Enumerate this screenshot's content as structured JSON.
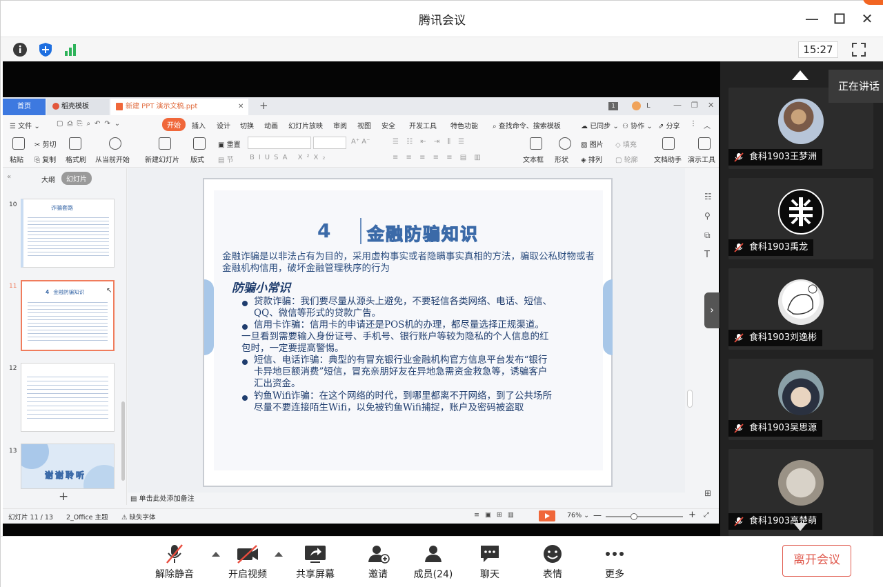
{
  "window": {
    "title": "腾讯会议",
    "time": "15:27"
  },
  "wps": {
    "tabs": [
      "首页",
      "稻壳模板",
      "新建 PPT 演示文稿.ppt"
    ],
    "menu": [
      "文件",
      "开始",
      "插入",
      "设计",
      "切换",
      "动画",
      "幻灯片放映",
      "审阅",
      "视图",
      "安全",
      "开发工具",
      "特色功能",
      "查找命令、搜索模板",
      "已同步",
      "协作",
      "分享"
    ],
    "ribbon": {
      "paste": "粘贴",
      "cut": "剪切",
      "copy": "复制",
      "format_brush": "格式刷",
      "from_current": "从当前开始",
      "new_slide": "新建幻灯片",
      "layout": "版式",
      "section": "节",
      "reset": "重置",
      "textbox": "文本框",
      "shape": "形状",
      "picture": "图片",
      "fill": "填充",
      "arrange": "排列",
      "outline": "轮廓",
      "doc_assistant": "文档助手",
      "present_tool": "演示工具"
    },
    "panel_tabs": [
      "大纲",
      "幻灯片"
    ],
    "thumb_numbers": [
      "10",
      "11",
      "12",
      "13"
    ],
    "thumb_titles": [
      "诈骗套路",
      "金融防骗知识",
      "",
      "谢谢聆听"
    ],
    "notes_placeholder": "单击此处添加备注",
    "status": {
      "slide": "幻灯片 11 / 13",
      "theme": "2_Office 主题",
      "font": "缺失字体",
      "zoom": "76%"
    }
  },
  "slide": {
    "number": "4",
    "title": "金融防骗知识",
    "intro": "金融诈骗是以非法占有为目的，采用虚构事实或者隐瞒事实真相的方法，骗取公私财物或者金融机构信用，破坏金融管理秩序的行为",
    "subtitle": "防骗小常识",
    "bullets": [
      {
        "lines": [
          "贷款诈骗：我们要尽量从源头上避免，不要轻信各类网络、电话、短信、",
          "QQ、微信等形式的贷款广告。"
        ]
      },
      {
        "lines": [
          "信用卡诈骗：信用卡的申请还是POS机的办理，都尽量选择正规渠道。"
        ],
        "extra": [
          "一旦看到需要输入身份证号、手机号、银行账户等较为隐私的个人信息的红",
          "包时，一定要提高警惕。"
        ]
      },
      {
        "lines": [
          "短信、电话诈骗：典型的有冒充银行业金融机构官方信息平台发布“银行",
          "卡异地巨额消费”短信，冒充亲朋好友在异地急需资金救急等，诱骗客户",
          "汇出资金。"
        ]
      },
      {
        "lines": [
          "钓鱼Wifi诈骗：在这个网络的时代，到哪里都离不开网络，到了公共场所",
          "尽量不要连接陌生Wifi，以免被钓鱼Wifi捕捉，账户及密码被盗取"
        ]
      }
    ]
  },
  "participants": {
    "speaking_label": "正在讲话",
    "members": [
      {
        "name": "食科1903王梦洲"
      },
      {
        "name": "食科1903禹龙"
      },
      {
        "name": "食科1903刘逸彬"
      },
      {
        "name": "食科1903吴思源"
      },
      {
        "name": "食科1903高楚萌"
      }
    ]
  },
  "toolbar": {
    "unmute": "解除静音",
    "start_video": "开启视频",
    "share_screen": "共享屏幕",
    "invite": "邀请",
    "members": "成员(24)",
    "chat": "聊天",
    "reactions": "表情",
    "more": "更多",
    "leave": "离开会议"
  },
  "colors": {
    "accent_red": "#e05a4e",
    "wps_orange": "#f0673a",
    "slide_blue": "#1f3d6e"
  }
}
